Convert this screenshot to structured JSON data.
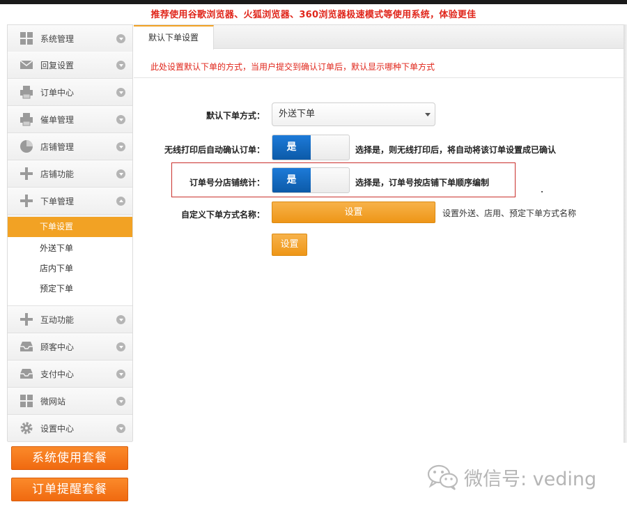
{
  "notice": "推荐使用谷歌浏览器、火狐浏览器、360浏览器极速模式等使用系统，体验更佳",
  "sidebar": {
    "items": [
      {
        "label": "系统管理",
        "icon": "grid-icon"
      },
      {
        "label": "回复设置",
        "icon": "envelope-icon"
      },
      {
        "label": "订单中心",
        "icon": "printer-icon"
      },
      {
        "label": "催单管理",
        "icon": "printer-icon"
      },
      {
        "label": "店铺管理",
        "icon": "pie-chart-icon"
      },
      {
        "label": "店铺功能",
        "icon": "plus-icon"
      },
      {
        "label": "下单管理",
        "icon": "plus-icon"
      },
      {
        "label": "互动功能",
        "icon": "plus-icon"
      },
      {
        "label": "顾客中心",
        "icon": "inbox-icon"
      },
      {
        "label": "支付中心",
        "icon": "inbox-icon"
      },
      {
        "label": "微网站",
        "icon": "grid-icon"
      },
      {
        "label": "设置中心",
        "icon": "gear-icon"
      }
    ],
    "submenu": [
      "下单设置",
      "外送下单",
      "店内下单",
      "预定下单"
    ],
    "packages": [
      "系统使用套餐",
      "订单提醒套餐"
    ]
  },
  "main": {
    "tab": "默认下单设置",
    "description": "此处设置默认下单的方式，当用户提交到确认订单后，默认显示哪种下单方式",
    "form": {
      "default_order_label": "默认下单方式：",
      "default_order_value": "外送下单",
      "auto_confirm_label": "无线打印后自动确认订单：",
      "auto_confirm_toggle": "是",
      "auto_confirm_hint": "选择是，则无线打印后，将自动将该订单设置成已确认",
      "order_number_label": "订单号分店铺统计：",
      "order_number_toggle": "是",
      "order_number_hint": "选择是，订单号按店铺下单顺序编制",
      "custom_name_label": "自定义下单方式名称：",
      "custom_name_button": "设置",
      "custom_name_hint": "设置外送、店用、预定下单方式名称",
      "save_button": "设置"
    }
  },
  "watermark": "微信号: veding",
  "colors": {
    "accent": "#f2a224",
    "alert": "#e0261b",
    "toggle_on": "#1d7ad8",
    "package": "#f06a10"
  }
}
